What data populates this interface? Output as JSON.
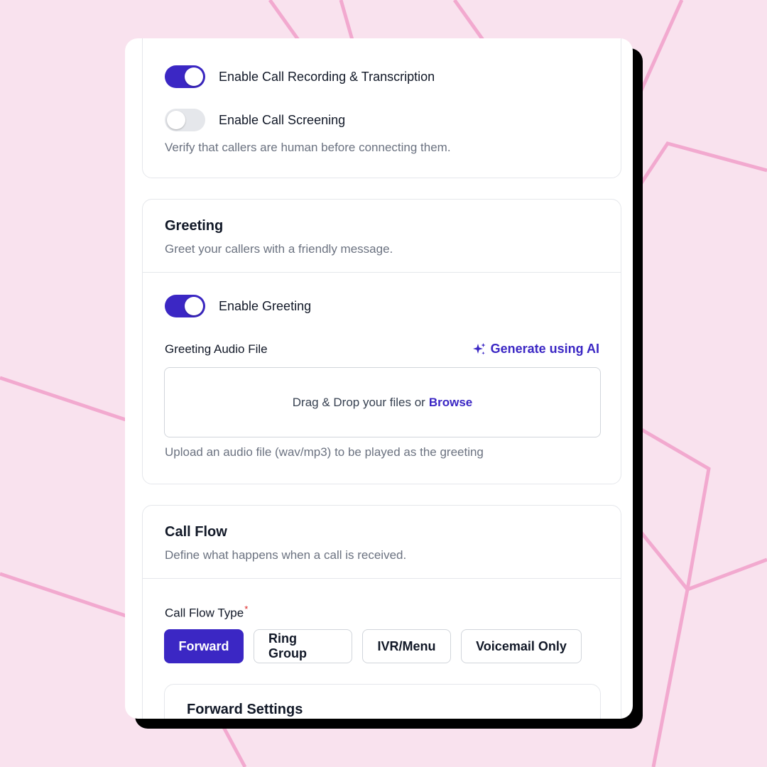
{
  "recording": {
    "toggle_on": true,
    "label": "Enable Call Recording & Transcription"
  },
  "screening": {
    "toggle_on": false,
    "label": "Enable Call Screening",
    "helper": "Verify that callers are human before connecting them."
  },
  "greeting": {
    "title": "Greeting",
    "subtitle": "Greet your callers with a friendly message.",
    "toggle_on": true,
    "toggle_label": "Enable Greeting",
    "audio_label": "Greeting Audio File",
    "ai_link": "Generate using AI",
    "ai_icon": "sparkles-icon",
    "dropzone_text": "Drag & Drop your files or",
    "dropzone_link": "Browse",
    "helper": "Upload an audio file (wav/mp3) to be played as the greeting"
  },
  "call_flow": {
    "title": "Call Flow",
    "subtitle": "Define what happens when a call is received.",
    "type_label": "Call Flow Type",
    "required_mark": "*",
    "options": [
      "Forward",
      "Ring Group",
      "IVR/Menu",
      "Voicemail Only"
    ],
    "selected": "Forward",
    "forward_settings_title": "Forward Settings"
  },
  "colors": {
    "accent": "#3b27c4",
    "background": "#f9e2ee",
    "decor_lines": "#f2a9cf"
  }
}
